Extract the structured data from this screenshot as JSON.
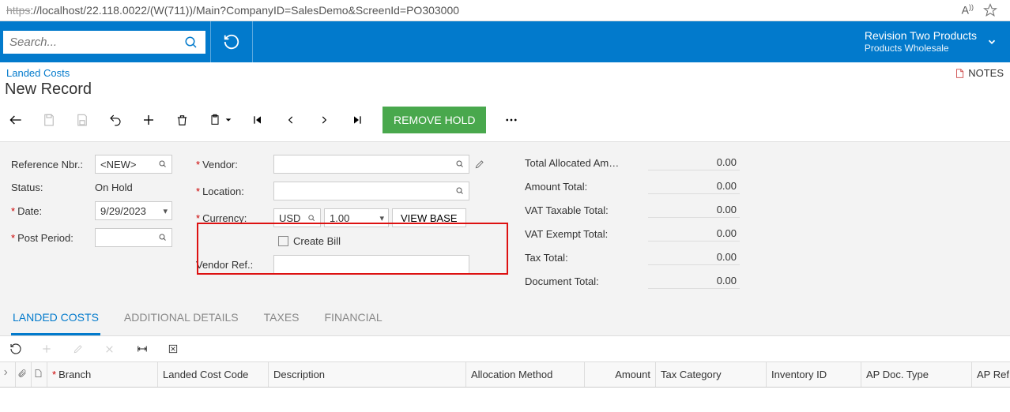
{
  "url": {
    "prefix": "https",
    "rest": "://localhost/22.118.0022/(W(711))/Main?CompanyID=SalesDemo&ScreenId=PO303000"
  },
  "search": {
    "placeholder": "Search..."
  },
  "company": {
    "line1": "Revision Two Products",
    "line2": "Products Wholesale"
  },
  "breadcrumb": "Landed Costs",
  "notes_label": "NOTES",
  "page_title": "New Record",
  "remove_hold": "REMOVE HOLD",
  "form": {
    "ref_nbr_label": "Reference Nbr.:",
    "ref_nbr_value": "<NEW>",
    "status_label": "Status:",
    "status_value": "On Hold",
    "date_label": "Date:",
    "date_value": "9/29/2023",
    "post_period_label": "Post Period:",
    "post_period_value": "",
    "vendor_label": "Vendor:",
    "location_label": "Location:",
    "currency_label": "Currency:",
    "currency_value": "USD",
    "rate_value": "1.00",
    "viewbase": "VIEW BASE",
    "create_bill_label": "Create Bill",
    "vendor_ref_label": "Vendor Ref.:"
  },
  "totals": {
    "alloc_label": "Total Allocated Am…",
    "alloc_val": "0.00",
    "amount_label": "Amount Total:",
    "amount_val": "0.00",
    "vat_tax_label": "VAT Taxable Total:",
    "vat_tax_val": "0.00",
    "vat_ex_label": "VAT Exempt Total:",
    "vat_ex_val": "0.00",
    "tax_label": "Tax Total:",
    "tax_val": "0.00",
    "doc_label": "Document Total:",
    "doc_val": "0.00"
  },
  "tabs": [
    "LANDED COSTS",
    "ADDITIONAL DETAILS",
    "TAXES",
    "FINANCIAL"
  ],
  "grid_cols": {
    "branch": "Branch",
    "code": "Landed Cost Code",
    "desc": "Description",
    "alloc": "Allocation Method",
    "amount": "Amount",
    "taxcat": "Tax Category",
    "inv": "Inventory ID",
    "apdoc": "AP Doc. Type",
    "apref": "AP Ref. Nbr"
  }
}
